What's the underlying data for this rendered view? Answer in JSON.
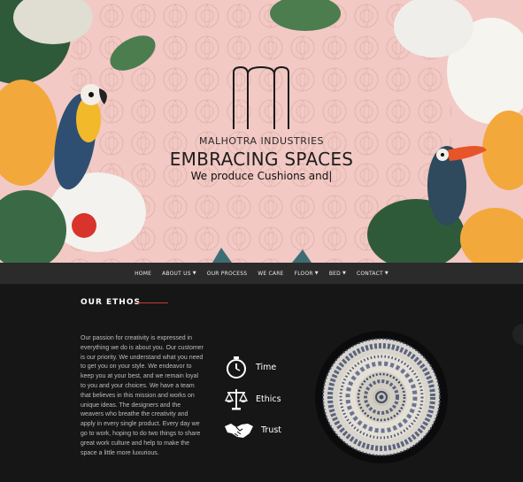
{
  "hero": {
    "company": "MALHOTRA INDUSTRIES",
    "tagline": "EMBRACING SPACES",
    "subline": "We produce Cushions and|",
    "background_color": "#f2c9c4"
  },
  "nav": {
    "items": [
      {
        "label": "HOME",
        "dropdown": false
      },
      {
        "label": "ABOUT US",
        "dropdown": true
      },
      {
        "label": "OUR PROCESS",
        "dropdown": false
      },
      {
        "label": "WE CARE",
        "dropdown": false
      },
      {
        "label": "FLOOR",
        "dropdown": true
      },
      {
        "label": "BED",
        "dropdown": true
      },
      {
        "label": "CONTACT",
        "dropdown": true
      }
    ],
    "dropdown_icon": "chevron-down-icon"
  },
  "ethos": {
    "title": "OUR ETHOS",
    "accent_color": "#c23a3a",
    "text": "Our passion for creativity is expressed in everything we do is about you. Our customer is our priority. We understand what you need to get you on your style. We endeavor to keep you at your best, and we remain loyal to you and your choices. We have a team that believes in this mission and works on unique ideas. The designers and the weavers who breathe the creativity and apply in every single product. Every day we go to work, hoping to do two things to share great work culture and help to make the space a little more luxurious."
  },
  "features": [
    {
      "label": "Time",
      "icon": "stopwatch-icon"
    },
    {
      "label": "Ethics",
      "icon": "scales-icon"
    },
    {
      "label": "Trust",
      "icon": "handshake-icon"
    }
  ]
}
